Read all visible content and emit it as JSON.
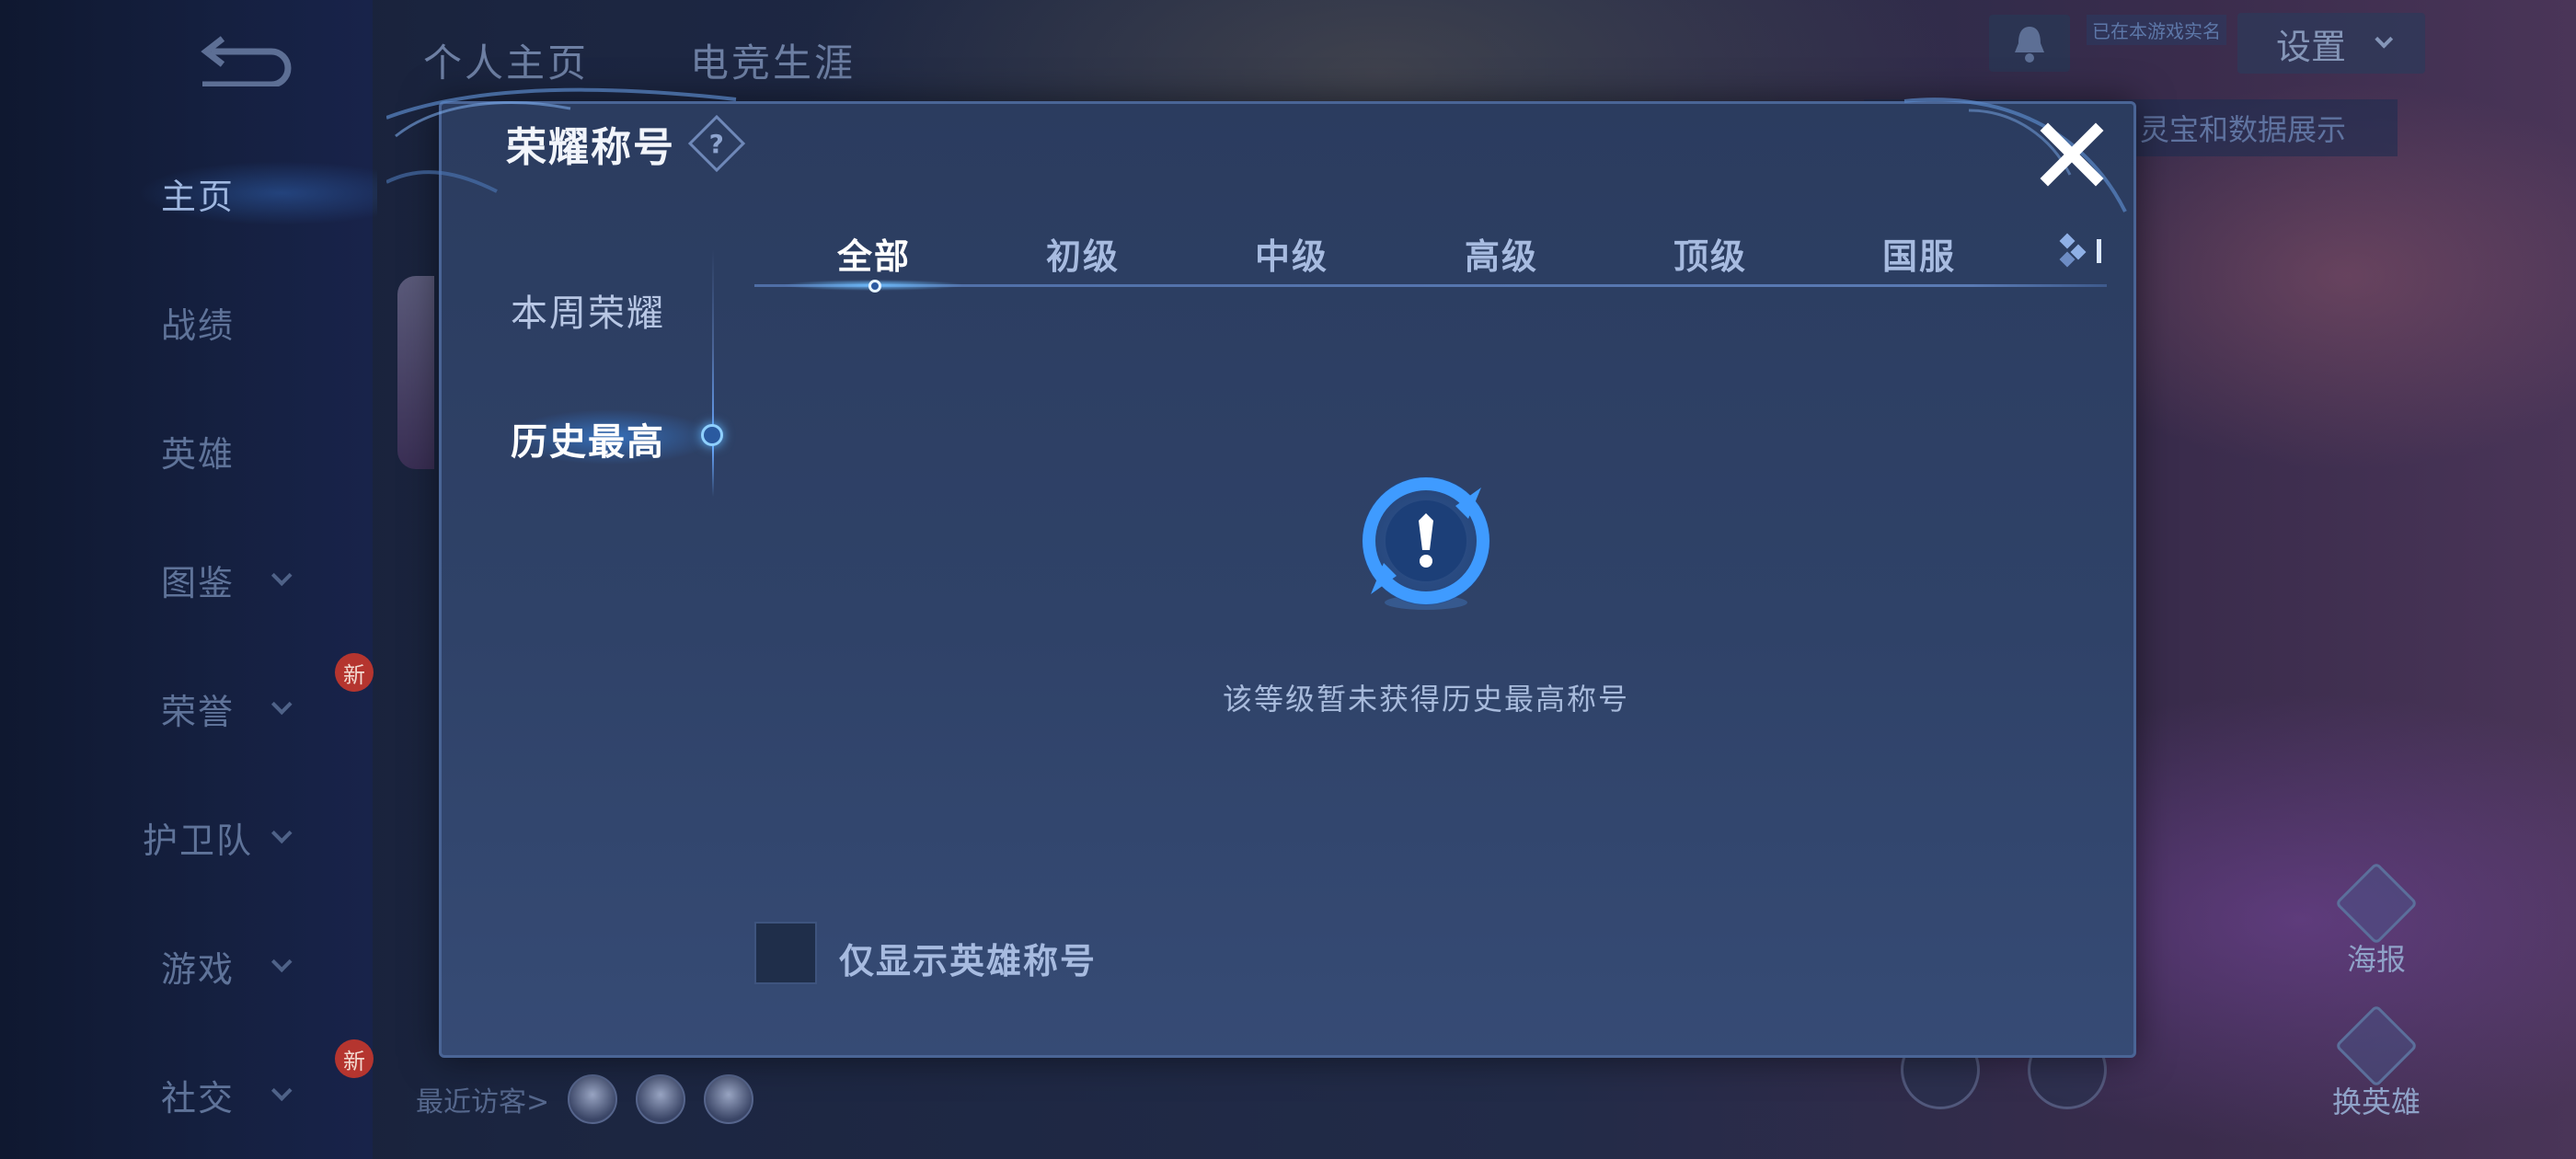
{
  "background": {
    "left_nav": [
      {
        "label": "主页",
        "active": true,
        "chevron": false,
        "badge": ""
      },
      {
        "label": "战绩",
        "active": false,
        "chevron": false,
        "badge": ""
      },
      {
        "label": "英雄",
        "active": false,
        "chevron": false,
        "badge": ""
      },
      {
        "label": "图鉴",
        "active": false,
        "chevron": true,
        "badge": ""
      },
      {
        "label": "荣誉",
        "active": false,
        "chevron": true,
        "badge": "新"
      },
      {
        "label": "护卫队",
        "active": false,
        "chevron": true,
        "badge": ""
      },
      {
        "label": "游戏",
        "active": false,
        "chevron": true,
        "badge": ""
      },
      {
        "label": "社交",
        "active": false,
        "chevron": true,
        "badge": "新"
      }
    ],
    "top_tabs": [
      "个人主页",
      "电竞生涯"
    ],
    "tag_text": "已在本游戏实名",
    "settings_label": "设置",
    "banner_text": "灵宝和数据展示",
    "right_buttons": [
      "海报",
      "换英雄"
    ],
    "visitors_label": "最近访客>"
  },
  "modal": {
    "title": "荣耀称号",
    "help_glyph": "?",
    "side_tabs": [
      {
        "label": "本周荣耀",
        "active": false
      },
      {
        "label": "历史最高",
        "active": true
      }
    ],
    "tabs": [
      {
        "label": "全部",
        "active": true
      },
      {
        "label": "初级",
        "active": false
      },
      {
        "label": "中级",
        "active": false
      },
      {
        "label": "高级",
        "active": false
      },
      {
        "label": "顶级",
        "active": false
      },
      {
        "label": "国服",
        "active": false
      }
    ],
    "empty_text": "该等级暂未获得历史最高称号",
    "checkbox_label": "仅显示英雄称号",
    "checkbox_checked": false
  },
  "colors": {
    "accent": "#5fb5ff",
    "modal_bg": "#2f4268",
    "badge": "#b5352f"
  }
}
